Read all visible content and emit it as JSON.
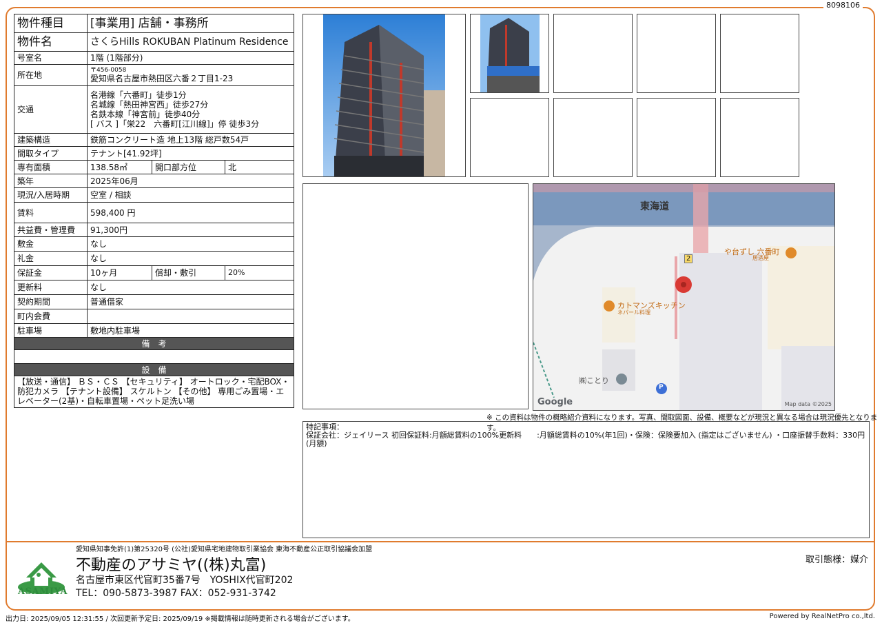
{
  "doc_id": "8098106",
  "spec": {
    "type": {
      "label": "物件種目",
      "value": "[事業用] 店舗・事務所"
    },
    "name": {
      "label": "物件名",
      "value": "さくらHills ROKUBAN Platinum Residence"
    },
    "room": {
      "label": "号室名",
      "value": "1階 (1階部分)"
    },
    "location": {
      "label": "所在地",
      "postal": "〒456-0058",
      "value": "愛知県名古屋市熱田区六番２丁目1-23"
    },
    "transport": {
      "label": "交通",
      "lines": [
        "名港線「六番町」徒歩1分",
        "名城線「熱田神宮西」徒歩27分",
        "名鉄本線「神宮前」徒歩40分",
        "[ バス ]「栄22　六番町[江川線]」停 徒歩3分"
      ]
    },
    "structure": {
      "label": "建築構造",
      "value": "鉄筋コンクリート造 地上13階 総戸数54戸"
    },
    "layout": {
      "label": "間取タイプ",
      "value": "テナント[41.92坪]"
    },
    "area": {
      "label": "専有面積",
      "value": "138.58㎡",
      "dir_label": "開口部方位",
      "dir_value": "北"
    },
    "built": {
      "label": "築年",
      "value": "2025年06月"
    },
    "status": {
      "label": "現況/入居時期",
      "value": "空室 / 相談"
    },
    "rent": {
      "label": "賃料",
      "value": "598,400 円"
    },
    "fee": {
      "label": "共益費・管理費",
      "value": "91,300円"
    },
    "deposit": {
      "label": "敷金",
      "value": "なし"
    },
    "keymoney": {
      "label": "礼金",
      "value": "なし"
    },
    "guarantee": {
      "label": "保証金",
      "value": "10ヶ月",
      "amort_label": "償却・敷引",
      "amort_value": "20%"
    },
    "renewal": {
      "label": "更新料",
      "value": "なし"
    },
    "contract": {
      "label": "契約期間",
      "value": "普通借家"
    },
    "community": {
      "label": "町内会費",
      "value": ""
    },
    "parking": {
      "label": "駐車場",
      "value": "敷地内駐車場"
    }
  },
  "sections": {
    "remarks_title": "備　考",
    "equip_title": "設　備",
    "equip_text": "【放送・通信】 ＢＳ・ＣＳ 【セキュリティ】 オートロック・宅配BOX・防犯カメラ 【テナント設備】 スケルトン 【その他】 専用ごみ置場・エレベーター(2基)・自転車置場・ペット足洗い場"
  },
  "map": {
    "road": "東海道",
    "route_no": "2",
    "poi1": "や台ずし 六番町",
    "poi1_sub": "居酒屋",
    "poi2": "カトマンズキッチン",
    "poi2_sub": "ネパール料理",
    "poi3": "㈱ことり",
    "parking": "P",
    "google": "Google",
    "credit": "Map data ©2025"
  },
  "note": "※ この資料は物件の概略紹介資料になります。写真、間取図面、設備、概要などが現況と異なる場合は現況優先となります。",
  "remarks": {
    "head": "特記事項：",
    "body": "保証会社：ジェイリース 初回保証料:月額総賃料の100%更新料　　:月額総賃料の10%(年1回)・保険：保険要加入 (指定はございません) ・口座振替手数料：330円 (月額)"
  },
  "company": {
    "assoc": "愛知県知事免許(1)第25320号 (公社)愛知県宅地建物取引業協会 東海不動産公正取引協議会加盟",
    "name": "不動産のアサミヤ((株)丸富)",
    "address": "名古屋市東区代官町35番7号　YOSHIX代官町202",
    "tel": "TEL：090-5873-3987 FAX：052-931-3742",
    "logo_text": "ASAMIYA",
    "trade_type": "取引態様：媒介"
  },
  "footer": {
    "left": "出力日: 2025/09/05 12:31:55 /  次回更新予定日: 2025/09/19 ※掲載情報は随時更新される場合がございます。",
    "right": "Powered by RealNetPro co.,ltd."
  },
  "colors": {
    "accent": "#e07b2e",
    "section_bg": "#555555",
    "logo_green": "#2e8b3c"
  }
}
